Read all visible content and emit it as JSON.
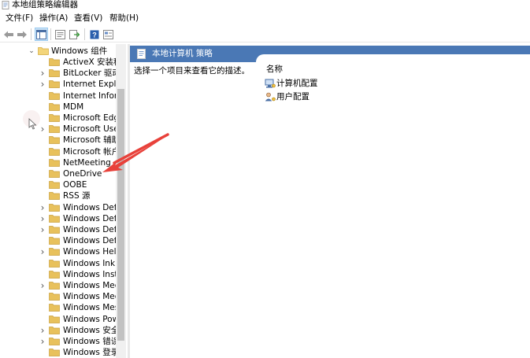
{
  "window": {
    "title": "本地组策略编辑器"
  },
  "menubar": {
    "items": [
      "文件(F)",
      "操作(A)",
      "查看(V)",
      "帮助(H)"
    ]
  },
  "toolbar": {
    "buttons": [
      "back-arrow-icon",
      "forward-arrow-icon",
      "show-hide-tree-icon",
      "properties-icon",
      "export-list-icon",
      "help-icon",
      "view-icon"
    ]
  },
  "tree": {
    "parent": "Windows 组件",
    "items": [
      {
        "label": "ActiveX 安装程序",
        "expandable": false
      },
      {
        "label": "BitLocker 驱动器",
        "expandable": true
      },
      {
        "label": "Internet Explorer",
        "expandable": true
      },
      {
        "label": "Internet Information",
        "expandable": false
      },
      {
        "label": "MDM",
        "expandable": false
      },
      {
        "label": "Microsoft Edge",
        "expandable": false
      },
      {
        "label": "Microsoft User E",
        "expandable": true
      },
      {
        "label": "Microsoft 辅助身",
        "expandable": false
      },
      {
        "label": "Microsoft 帐户",
        "expandable": false
      },
      {
        "label": "NetMeeting",
        "expandable": false
      },
      {
        "label": "OneDrive",
        "expandable": false
      },
      {
        "label": "OOBE",
        "expandable": false
      },
      {
        "label": "RSS 源",
        "expandable": false
      },
      {
        "label": "Windows Defen",
        "expandable": true
      },
      {
        "label": "Windows Defen",
        "expandable": true
      },
      {
        "label": "Windows Defen",
        "expandable": true
      },
      {
        "label": "Windows Defen",
        "expandable": false
      },
      {
        "label": "Windows Hello",
        "expandable": true
      },
      {
        "label": "Windows Ink 工",
        "expandable": false
      },
      {
        "label": "Windows Install",
        "expandable": false
      },
      {
        "label": "Windows Media",
        "expandable": true
      },
      {
        "label": "Windows Media",
        "expandable": false
      },
      {
        "label": "Windows Messe",
        "expandable": false
      },
      {
        "label": "Windows Power",
        "expandable": false
      },
      {
        "label": "Windows 安全中",
        "expandable": true
      },
      {
        "label": "Windows 错误报",
        "expandable": true
      },
      {
        "label": "Windows 登录选",
        "expandable": false
      }
    ]
  },
  "right_pane": {
    "header_title": "本地计算机 策略",
    "description": "选择一个项目来查看它的描述。",
    "column_header": "名称",
    "items": [
      {
        "label": "计算机配置",
        "icon": "computer-config-icon"
      },
      {
        "label": "用户配置",
        "icon": "user-config-icon"
      }
    ]
  },
  "colors": {
    "header_bg": "#4a78b5",
    "folder": "#e8c15c",
    "annotation_arrow": "#e8413a"
  }
}
